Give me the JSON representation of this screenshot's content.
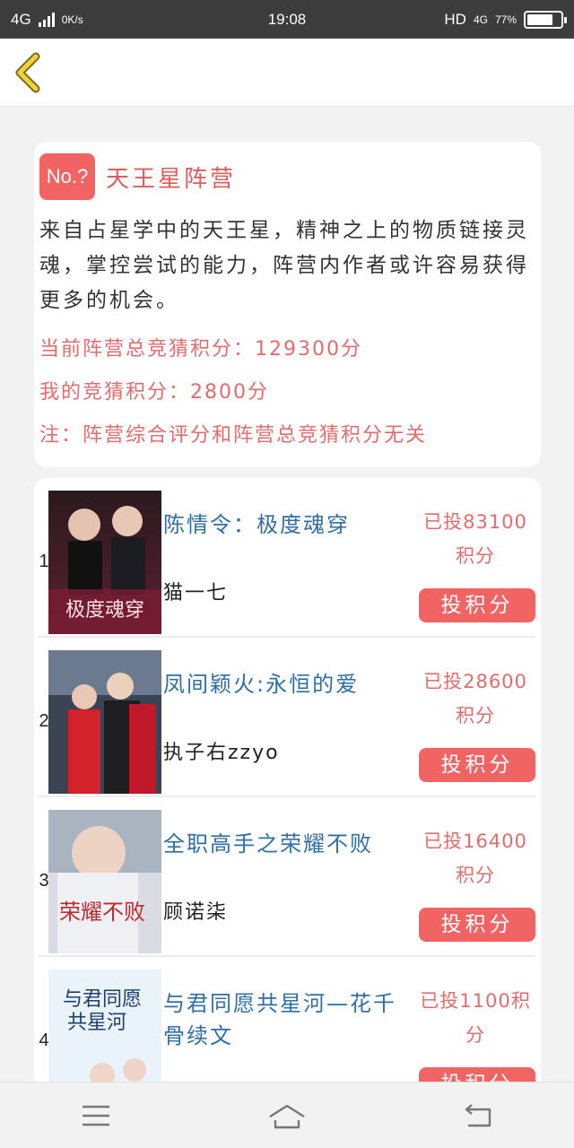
{
  "status_bar": {
    "network": "4G",
    "speed": "0K/s",
    "time": "19:08",
    "hd": "HD",
    "network2": "4G",
    "battery": "77%",
    "battery_level": 0.77
  },
  "camp": {
    "badge": "No.?",
    "name": "天王星阵营",
    "description": "来自占星学中的天王星，精神之上的物质链接灵魂，掌控尝试的能力，阵营内作者或许容易获得更多的机会。",
    "total_points": "当前阵营总竞猜积分：129300分",
    "my_points": "我的竞猜积分：2800分",
    "note": "注：阵营综合评分和阵营总竞猜积分无关"
  },
  "books": [
    {
      "rank": "1",
      "title": "陈情令：极度魂穿",
      "author": "猫一七",
      "voted_line1": "已投83100",
      "voted_line2": "积分",
      "button": "投积分"
    },
    {
      "rank": "2",
      "title": "凤间颖火:永恒的爱",
      "author": "执子右zzyo",
      "voted_line1": "已投28600",
      "voted_line2": "积分",
      "button": "投积分"
    },
    {
      "rank": "3",
      "title": "全职高手之荣耀不败",
      "author": "顾诺柒",
      "voted_line1": "已投16400",
      "voted_line2": "积分",
      "button": "投积分"
    },
    {
      "rank": "4",
      "title": "与君同愿共星河—花千骨续文",
      "author": "",
      "voted_line1": "已投1100积",
      "voted_line2": "分",
      "button": "投积分"
    }
  ],
  "colors": {
    "accent": "#f26464",
    "title_blue": "#2f6fa8",
    "status_bar": "#3c3c3c"
  },
  "icons": {
    "back": "chevron-left-icon",
    "menu": "menu-icon",
    "home": "home-icon",
    "return": "return-icon"
  }
}
